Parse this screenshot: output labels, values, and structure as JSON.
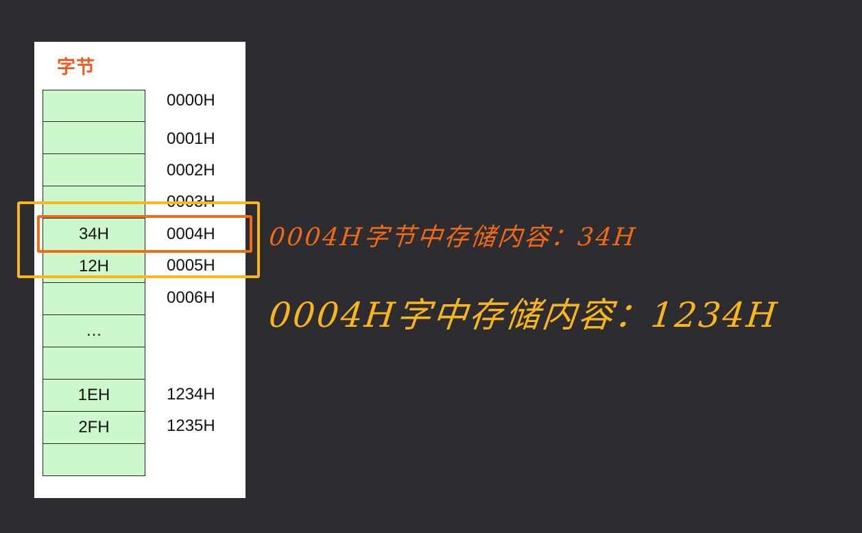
{
  "title": "字节",
  "cells": [
    "",
    "",
    "",
    "",
    "34H",
    "12H",
    "",
    "…",
    "",
    "1EH",
    "2FH",
    ""
  ],
  "addresses": [
    "0000H",
    "0001H",
    "0002H",
    "0003H",
    "0004H",
    "0005H",
    "0006H",
    "1234H",
    "1235H"
  ],
  "annotations": {
    "byte_note": "0004H字节中存储内容：34H",
    "word_note": "0004H字中存储内容：1234H"
  },
  "colors": {
    "background": "#2d2c30",
    "panel": "#ffffff",
    "cell_fill": "#ccf8cc",
    "title": "#f05a1e",
    "byte_highlight": "#f26a14",
    "word_highlight": "#f8b51c"
  }
}
